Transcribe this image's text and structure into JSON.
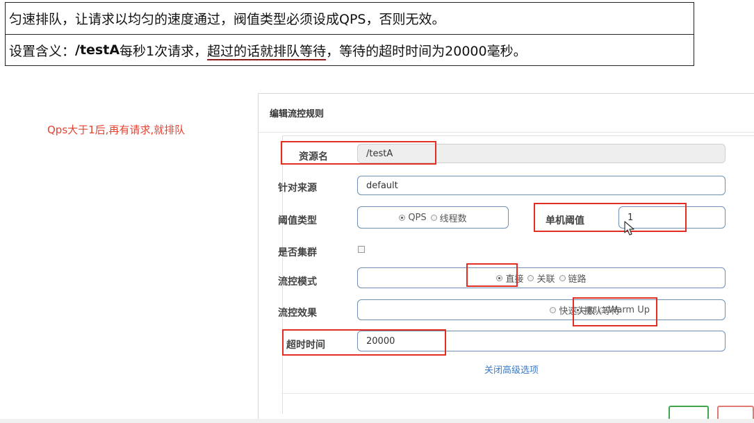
{
  "notes": {
    "row1": "匀速排队，让请求以均匀的速度通过，阀值类型必须设成QPS，否则无效。",
    "row2_prefix": "设置含义：",
    "row2_bold": "/testA",
    "row2_mid": "每秒1次请求，",
    "row2_underlined": "超过的话就排队等待",
    "row2_suffix": "，等待的超时时间为20000毫秒。"
  },
  "side_note": "Qps大于1后,再有请求,就排队",
  "dialog": {
    "title": "编辑流控规则",
    "resource_label": "资源名",
    "resource_value": "/testA",
    "source_label": "针对来源",
    "source_value": "default",
    "threshold_type_label": "阈值类型",
    "threshold_type_options": [
      "QPS",
      "线程数"
    ],
    "threshold_type_selected": "QPS",
    "single_threshold_label": "单机阈值",
    "single_threshold_value": "1",
    "cluster_label": "是否集群",
    "flow_mode_label": "流控模式",
    "flow_mode_options": [
      "直接",
      "关联",
      "链路"
    ],
    "flow_mode_selected": "直接",
    "flow_effect_label": "流控效果",
    "flow_effect_options": [
      "快速失败",
      "Warm Up",
      "排队等待"
    ],
    "flow_effect_selected": "排队等待",
    "timeout_label": "超时时间",
    "timeout_value": "20000",
    "advanced_link": "关闭高级选项"
  },
  "colors": {
    "highlight": "#e32d22",
    "link": "#3a7bc8",
    "input_border": "#6d8fb3",
    "side_note": "#e8402f"
  }
}
